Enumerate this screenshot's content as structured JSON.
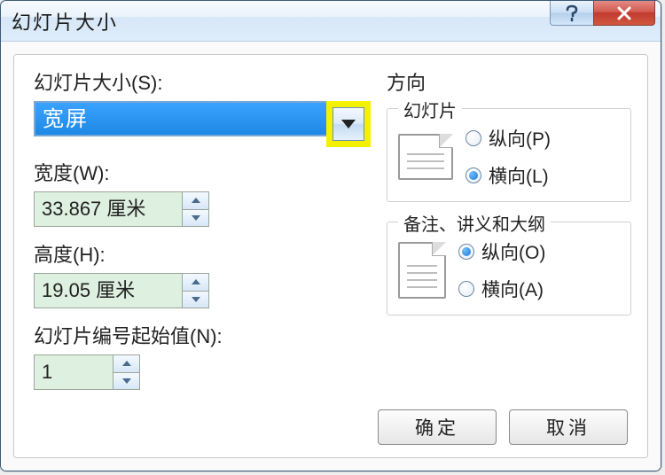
{
  "window": {
    "title": "幻灯片大小"
  },
  "left": {
    "size_label": "幻灯片大小(S):",
    "size_value": "宽屏",
    "width_label": "宽度(W):",
    "width_value": "33.867 厘米",
    "height_label": "高度(H):",
    "height_value": "19.05 厘米",
    "start_num_label": "幻灯片编号起始值(N):",
    "start_num_value": "1"
  },
  "right": {
    "direction_header": "方向",
    "slides_legend": "幻灯片",
    "slides_portrait_label": "纵向(P)",
    "slides_landscape_label": "横向(L)",
    "slides_selected": "landscape",
    "notes_legend": "备注、讲义和大纲",
    "notes_portrait_label": "纵向(O)",
    "notes_landscape_label": "横向(A)",
    "notes_selected": "portrait"
  },
  "buttons": {
    "ok": "确定",
    "cancel": "取消"
  }
}
